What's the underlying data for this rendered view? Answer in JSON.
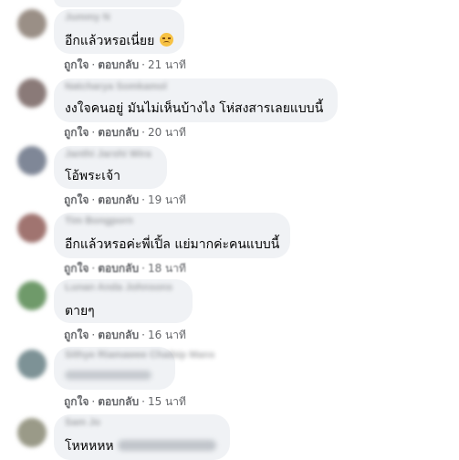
{
  "comments": [
    {
      "name": "Jummy N",
      "text": "อีกแล้วหรอเนี่ยย",
      "emoji": "disappointed-face",
      "like": "ถูกใจ",
      "reply": "ตอบกลับ",
      "time": "21 นาที"
    },
    {
      "name": "Natcharya Somkamol",
      "text": "งงใจคนอยู่ มันไม่เห็นบ้างไง โห่สงสารเลยแบบนี้",
      "like": "ถูกใจ",
      "reply": "ตอบกลับ",
      "time": "20 นาที"
    },
    {
      "name": "Janthi Jarshi Wira",
      "text": "โอ้พระเจ้า",
      "like": "ถูกใจ",
      "reply": "ตอบกลับ",
      "time": "19 นาที"
    },
    {
      "name": "Tim Bongporn",
      "text": "อีกแล้วหรอค่ะพี่เปิ้ล แย่มากค่ะคนแบบนี้",
      "like": "ถูกใจ",
      "reply": "ตอบกลับ",
      "time": "18 นาที"
    },
    {
      "name": "Lunan Anda Johnsons",
      "text": "ตายๆ",
      "like": "ถูกใจ",
      "reply": "ตอบกลับ",
      "time": "16 นาที"
    },
    {
      "name": "Sithye Riamawee Chaibip Mans",
      "text": "",
      "like": "ถูกใจ",
      "reply": "ตอบกลับ",
      "time": "15 นาที"
    },
    {
      "name": "Sam Jo",
      "text": "โหหหหห",
      "like": "",
      "reply": "",
      "time": ""
    }
  ],
  "colors": {
    "bubble": "#f0f2f5",
    "text": "#050505",
    "meta": "#65676b"
  }
}
